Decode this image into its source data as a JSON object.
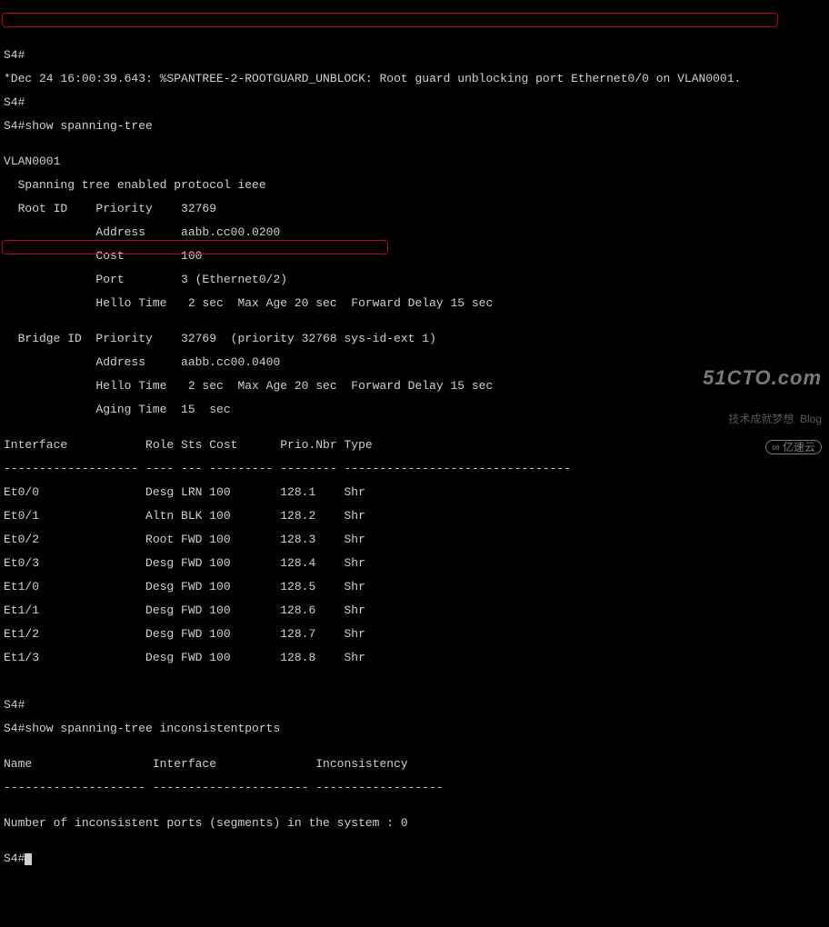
{
  "prompts": {
    "p1": "S4#",
    "p2": "S4#",
    "p3": "S4#show spanning-tree",
    "p4": "S4#",
    "p5": "S4#show spanning-tree inconsistentports",
    "p6": "S4#"
  },
  "log": "*Dec 24 16:00:39.643: %SPANTREE-2-ROOTGUARD_UNBLOCK: Root guard unblocking port Ethernet0/0 on VLAN0001.",
  "blank": "",
  "vlan_header": "VLAN0001",
  "stp_mode": "  Spanning tree enabled protocol ieee",
  "root": {
    "l1": "  Root ID    Priority    32769",
    "l2": "             Address     aabb.cc00.0200",
    "l3": "             Cost        100",
    "l4": "             Port        3 (Ethernet0/2)",
    "l5": "             Hello Time   2 sec  Max Age 20 sec  Forward Delay 15 sec"
  },
  "bridge": {
    "l1": "  Bridge ID  Priority    32769  (priority 32768 sys-id-ext 1)",
    "l2": "             Address     aabb.cc00.0400",
    "l3": "             Hello Time   2 sec  Max Age 20 sec  Forward Delay 15 sec",
    "l4": "             Aging Time  15  sec"
  },
  "table": {
    "header": "Interface           Role Sts Cost      Prio.Nbr Type",
    "divider": "------------------- ---- --- --------- -------- --------------------------------",
    "rows": {
      "r0": "Et0/0               Desg LRN 100       128.1    Shr",
      "r1": "Et0/1               Altn BLK 100       128.2    Shr",
      "r2": "Et0/2               Root FWD 100       128.3    Shr",
      "r3": "Et0/3               Desg FWD 100       128.4    Shr",
      "r4": "Et1/0               Desg FWD 100       128.5    Shr",
      "r5": "Et1/1               Desg FWD 100       128.6    Shr",
      "r6": "Et1/2               Desg FWD 100       128.7    Shr",
      "r7": "Et1/3               Desg FWD 100       128.8    Shr"
    }
  },
  "inconsistent": {
    "header": "Name                 Interface              Inconsistency",
    "divider": "-------------------- ---------------------- ------------------",
    "summary": "Number of inconsistent ports (segments) in the system : 0"
  },
  "watermark": {
    "big": "51CTO.com",
    "small": "技术成就梦想  Blog",
    "tag": "∞ 亿速云"
  }
}
